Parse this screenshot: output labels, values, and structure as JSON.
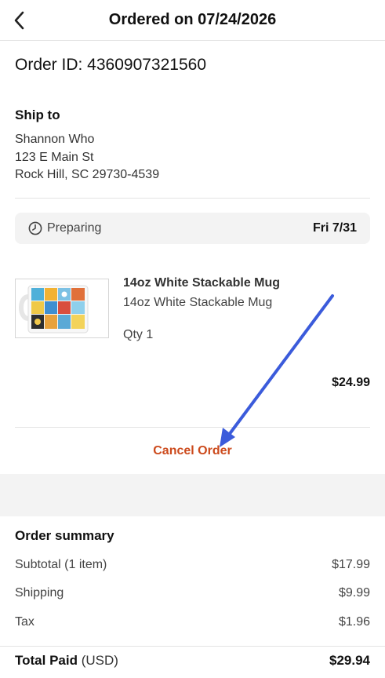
{
  "header": {
    "title": "Ordered on 07/24/2026",
    "back_icon": "chevron-left-icon"
  },
  "order": {
    "id_text": "Order ID: 4360907321560"
  },
  "shipping": {
    "heading": "Ship to",
    "name": "Shannon Who",
    "street": "123 E Main St",
    "city_line": "Rock Hill, SC 29730-4539"
  },
  "status": {
    "icon": "clock-icon",
    "label": "Preparing",
    "date": "Fri 7/31"
  },
  "item": {
    "title": "14oz White Stackable Mug",
    "variant": "14oz White Stackable Mug",
    "qty": "Qty 1",
    "price": "$24.99"
  },
  "actions": {
    "cancel_label": "Cancel Order",
    "cancel_color": "#cc4a1c"
  },
  "annotation": {
    "arrow_color": "#3b5bdb"
  },
  "summary": {
    "heading": "Order summary",
    "rows": [
      {
        "label": "Subtotal (1 item)",
        "value": "$17.99"
      },
      {
        "label": "Shipping",
        "value": "$9.99"
      },
      {
        "label": "Tax",
        "value": "$1.96"
      }
    ],
    "total_label": "Total Paid",
    "total_unit": "(USD)",
    "total_value": "$29.94"
  }
}
